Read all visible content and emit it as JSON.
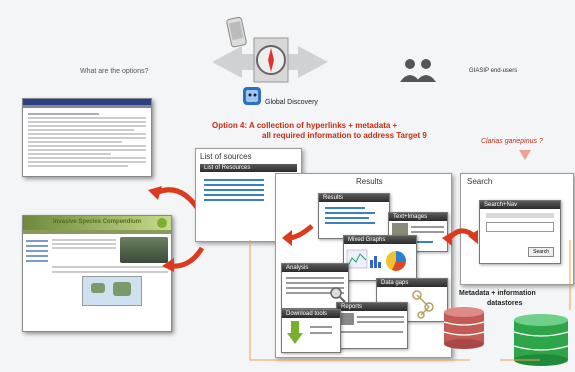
{
  "header": {
    "question": "What are the options?",
    "end_users": "GIASIP end-users",
    "global_discovery": "Global Discovery"
  },
  "option": {
    "line1": "Option 4: A collection of hyperlinks + metadata +",
    "line2": "all required information to address Target 9"
  },
  "query": {
    "text": "Clarias gariepinus ?"
  },
  "website": {
    "title": "Invasive Species Compendium"
  },
  "panels": {
    "sources_title": "List of sources",
    "sources_bar": "List of Resources",
    "results_title": "Results",
    "results_sub": "Results",
    "search_title": "Search",
    "search_bar": "Search+Nav",
    "search_button": "Search"
  },
  "windows": {
    "text_images": "Text+Images",
    "mixed_graphs": "Mixed Graphs",
    "analysis": "Analysis",
    "data_gaps": "Data gaps",
    "reports": "Reports",
    "download": "Download tools"
  },
  "datastores": {
    "label_line1": "Metadata + information",
    "label_line2": "datastores"
  },
  "colors": {
    "accent_red": "#cc2b12",
    "arrow_red": "#dc3a1c",
    "link_blue": "#3d7fc4",
    "db_red": "#c25a55",
    "db_green": "#2fa54a"
  }
}
